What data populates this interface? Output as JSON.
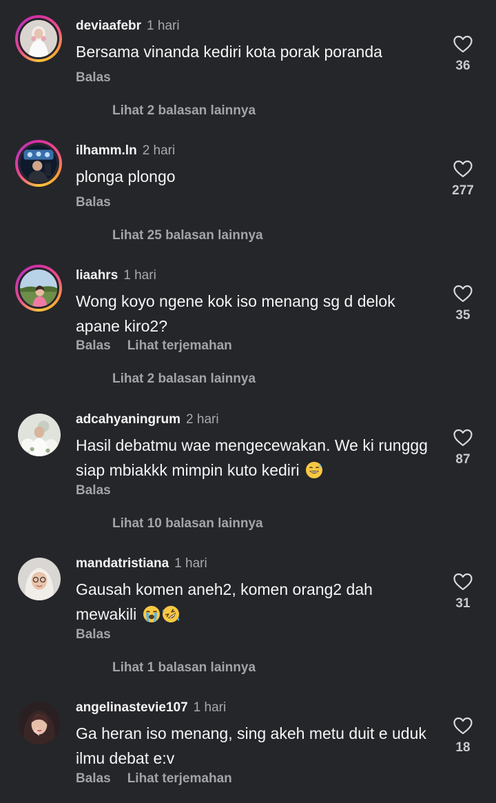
{
  "comments": [
    {
      "username": "deviaafebr",
      "time": "1 hari",
      "text": "Bersama vinanda kediri kota porak poranda",
      "reply_label": "Balas",
      "translate_label": "",
      "replies_label": "Lihat 2 balasan lainnya",
      "likes": "36"
    },
    {
      "username": "ilhamm.ln",
      "time": "2 hari",
      "text": "plonga plongo",
      "reply_label": "Balas",
      "translate_label": "",
      "replies_label": "Lihat 25 balasan lainnya",
      "likes": "277"
    },
    {
      "username": "liaahrs",
      "time": "1 hari",
      "text": "Wong koyo ngene kok iso menang sg d delok apane kiro2?",
      "reply_label": "Balas",
      "translate_label": "Lihat terjemahan",
      "replies_label": "Lihat 2 balasan lainnya",
      "likes": "35"
    },
    {
      "username": "adcahyaningrum",
      "time": "2 hari",
      "text": "Hasil debatmu wae mengecewakan. We ki runggg siap mbiakkk mimpin kuto kediri",
      "reply_label": "Balas",
      "translate_label": "",
      "replies_label": "Lihat 10 balasan lainnya",
      "likes": "87"
    },
    {
      "username": "mandatristiana",
      "time": "1 hari",
      "text": "Gausah komen aneh2, komen orang2 dah mewakili",
      "reply_label": "Balas",
      "translate_label": "",
      "replies_label": "Lihat 1 balasan lainnya",
      "likes": "31"
    },
    {
      "username": "angelinastevie107",
      "time": "1 hari",
      "text": "Ga heran iso menang, sing akeh metu duit e uduk ilmu debat e:v",
      "reply_label": "Balas",
      "translate_label": "Lihat terjemahan",
      "replies_label": "",
      "likes": "18"
    }
  ],
  "icons": {
    "like": "heart-outline-icon",
    "emoji_sweat_smile": "grinning-sweat-emoji",
    "emoji_crying": "loudly-crying-emoji",
    "emoji_rofl": "rolling-on-floor-laughing-emoji"
  },
  "colors": {
    "background": "#25262a",
    "text": "#f5f5f5",
    "muted": "#a3a4a8",
    "story_ring": "#e8478f"
  }
}
